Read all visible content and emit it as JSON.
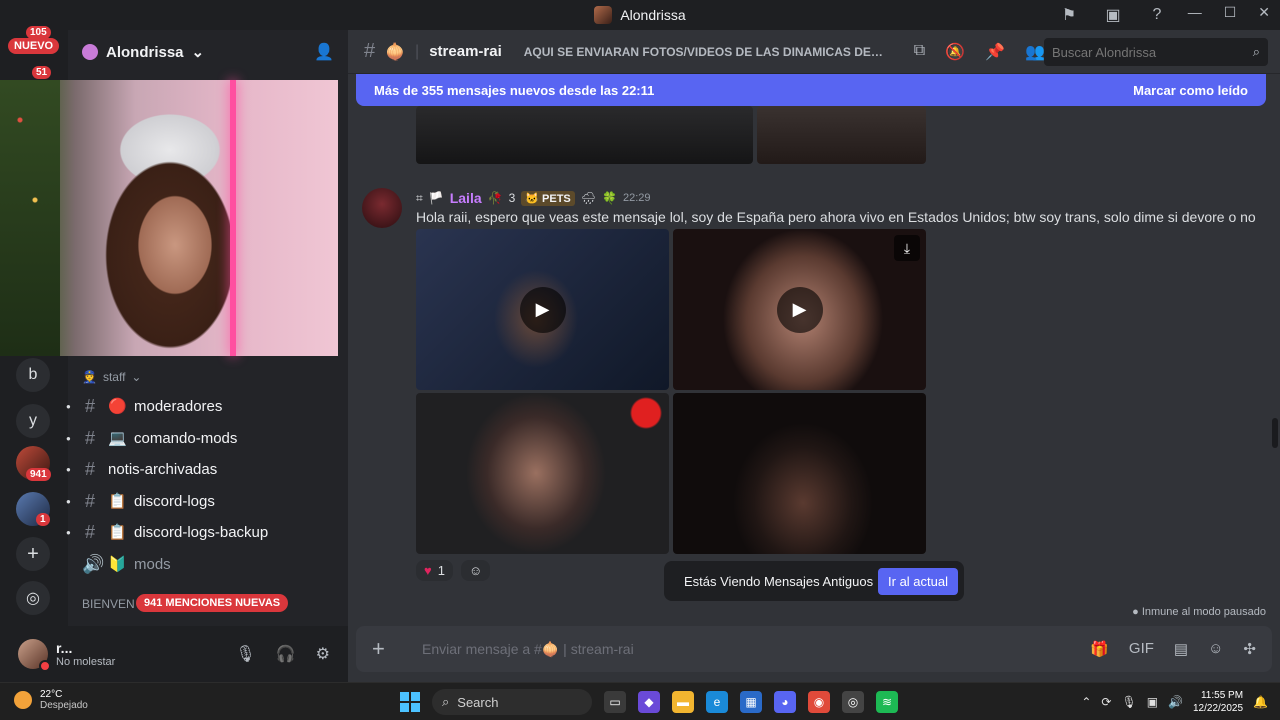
{
  "window": {
    "title": "Alondrissa"
  },
  "rail": {
    "top_count": "105",
    "nuevo_label": "NUEVO",
    "nuevo_count": "51",
    "servers": [
      {
        "label": "b"
      },
      {
        "label": "y"
      }
    ],
    "badge_941": "941",
    "badge_1": "1"
  },
  "server": {
    "name": "Alondrissa"
  },
  "sidebar": {
    "category": "staff",
    "channels": [
      {
        "emoji": "🔴",
        "name": "moderadores"
      },
      {
        "emoji": "💻",
        "name": "comando-mods"
      },
      {
        "emoji": "",
        "name": "notis-archivadas"
      },
      {
        "emoji": "📋",
        "name": "discord-logs"
      },
      {
        "emoji": "📋",
        "name": "discord-logs-backup"
      },
      {
        "emoji": "🔰",
        "name": "mods"
      }
    ],
    "bienvenida": "BIENVEN",
    "mentions_label": "941 MENCIONES NUEVAS"
  },
  "user": {
    "name": "r...",
    "status": "No molestar"
  },
  "channel": {
    "name": "stream-rai",
    "topic": "AQUI SE ENVIARAN FOTOS/VIDEOS DE LAS DINAMICAS DEL ..."
  },
  "search": {
    "placeholder": "Buscar Alondrissa"
  },
  "newbar": {
    "text": "Más de 355 mensajes nuevos desde las 22:11",
    "mark_read": "Marcar como leído"
  },
  "message": {
    "author": "Laila",
    "number": "3",
    "tag": "PETS",
    "time": "22:29",
    "text": "Hola raii, espero que veas este mensaje lol, soy de España pero ahora vivo en Estados Unidos; btw soy trans, solo dime si devore o no",
    "reaction_count": "1"
  },
  "old_messages": {
    "text": "Estás Viendo Mensajes Antiguos",
    "button": "Ir al actual"
  },
  "immune": "Inmune al modo pausado",
  "composer": {
    "placeholder": "Enviar mensaje a #🧅 | stream-rai"
  },
  "taskbar": {
    "temp": "22°C",
    "weather": "Despejado",
    "search": "Search",
    "time": "11:55 PM",
    "date": "12/22/2025"
  }
}
